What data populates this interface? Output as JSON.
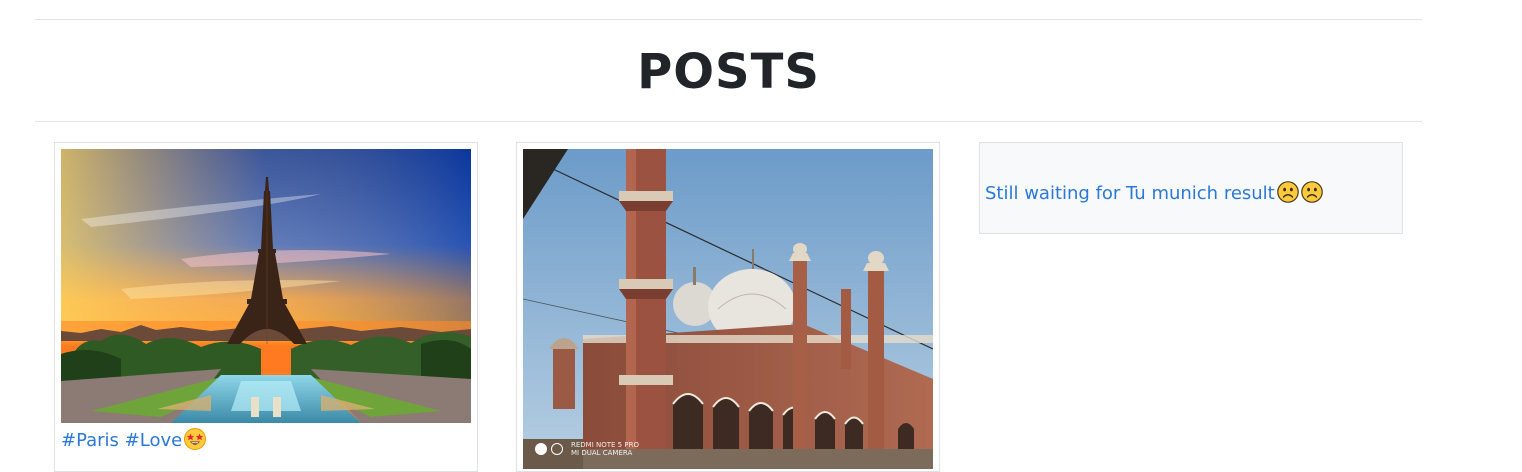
{
  "page": {
    "title": "POSTS"
  },
  "posts": [
    {
      "type": "image",
      "image_subject": "Eiffel Tower at sunset with Trocadero fountains",
      "caption": "#Paris #Love",
      "caption_emoji": "star-struck-emoji"
    },
    {
      "type": "image",
      "image_subject": "Jama Masjid mosque with minarets and domes under blue sky",
      "watermark_lines": [
        "REDMI NOTE 5 PRO",
        "MI DUAL CAMERA"
      ]
    },
    {
      "type": "text",
      "text": "Still waiting for Tu munich result",
      "emojis": [
        "frowning-face-emoji",
        "frowning-face-emoji"
      ]
    }
  ],
  "colors": {
    "link": "#2a78d8",
    "heading": "#212529",
    "card_border": "#dee2e6",
    "text_card_bg": "#f8f9fa"
  }
}
